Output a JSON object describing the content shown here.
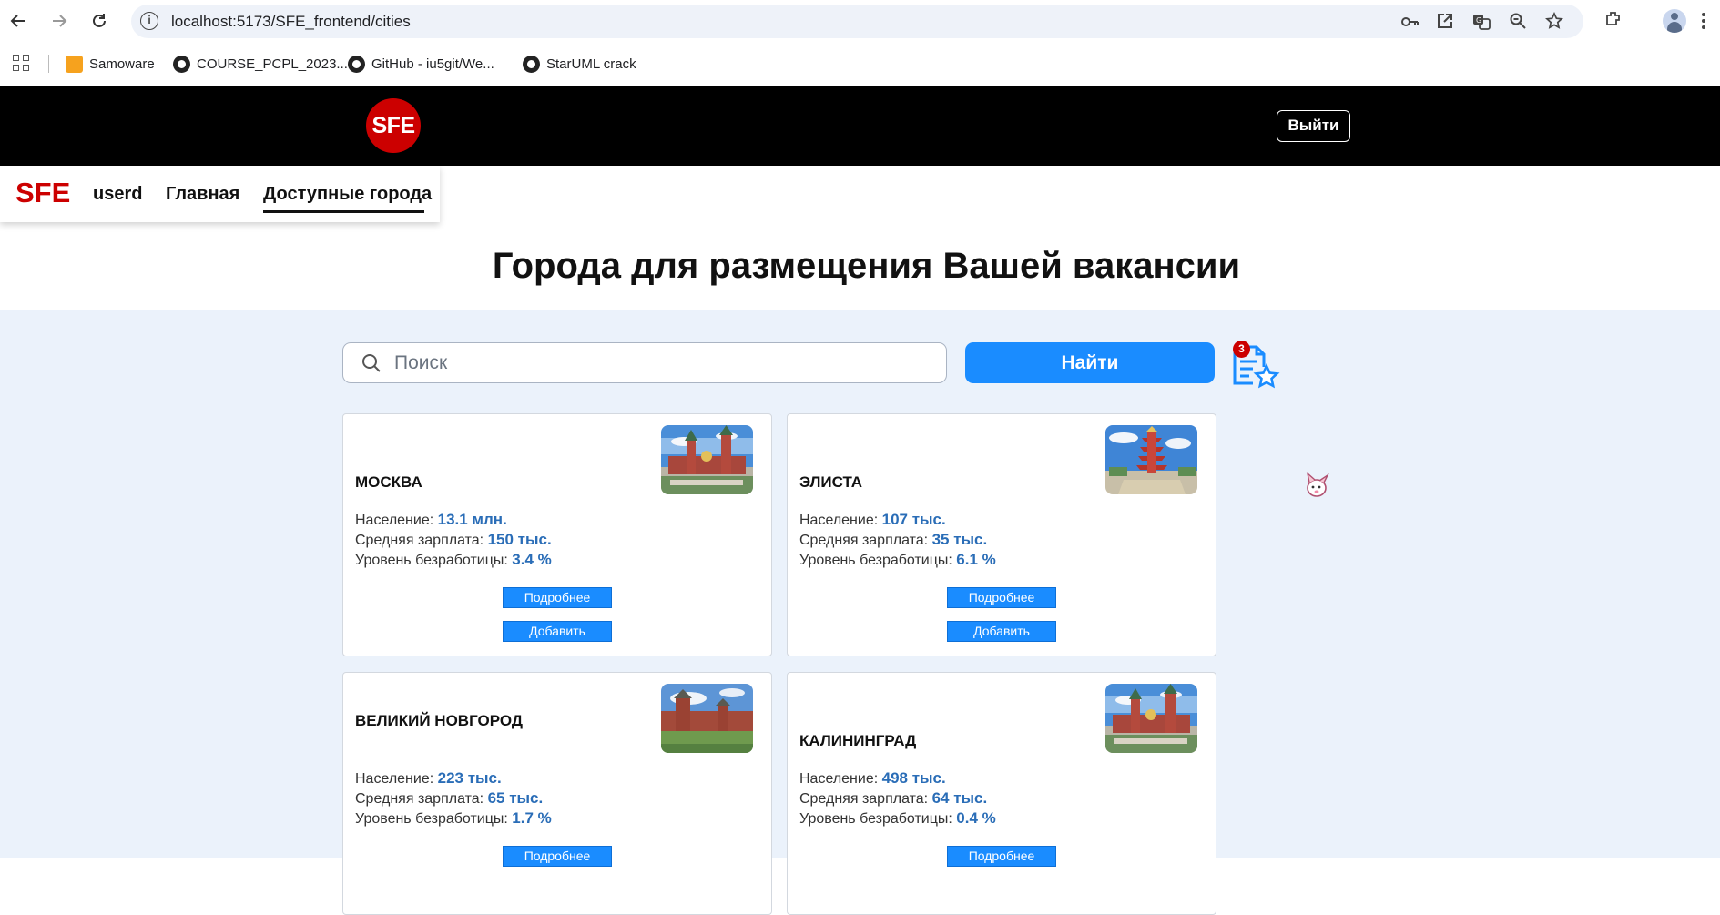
{
  "browser": {
    "url": "localhost:5173/SFE_frontend/cities",
    "bookmarks": [
      "Samoware",
      "COURSE_PCPL_2023...",
      "GitHub - iu5git/We...",
      "StarUML crack"
    ]
  },
  "header": {
    "logo_text": "SFE",
    "logout_label": "Выйти"
  },
  "navbar": {
    "brand": "SFE",
    "user": "userd",
    "home": "Главная",
    "cities": "Доступные города"
  },
  "page": {
    "title": "Города для размещения Вашей вакансии"
  },
  "search": {
    "placeholder": "Поиск",
    "button_label": "Найти",
    "favorites_count": "3"
  },
  "card_labels": {
    "population": "Население: ",
    "salary": "Средняя зарплата: ",
    "unemployment": "Уровень безработицы: ",
    "details_button": "Подробнее",
    "add_button": "Добавить"
  },
  "cities": [
    {
      "name": "МОСКВА",
      "population": "13.1 млн.",
      "salary": "150 тыс.",
      "unemployment": "3.4 %",
      "image": "kremlin"
    },
    {
      "name": "ЭЛИСТА",
      "population": "107 тыс.",
      "salary": "35 тыс.",
      "unemployment": "6.1 %",
      "image": "pagoda"
    },
    {
      "name": "ВЕЛИКИЙ НОВГОРОД",
      "population": "223 тыс.",
      "salary": "65 тыс.",
      "unemployment": "1.7 %",
      "image": "kremlin-wall"
    },
    {
      "name": "КАЛИНИНГРАД",
      "population": "498 тыс.",
      "salary": "64 тыс.",
      "unemployment": "0.4 %",
      "image": "kremlin"
    }
  ],
  "colors": {
    "brand_red": "#cc0000",
    "primary_blue": "#1a8cff",
    "value_blue": "#2a6db7",
    "content_bg": "#ebf2fb"
  }
}
